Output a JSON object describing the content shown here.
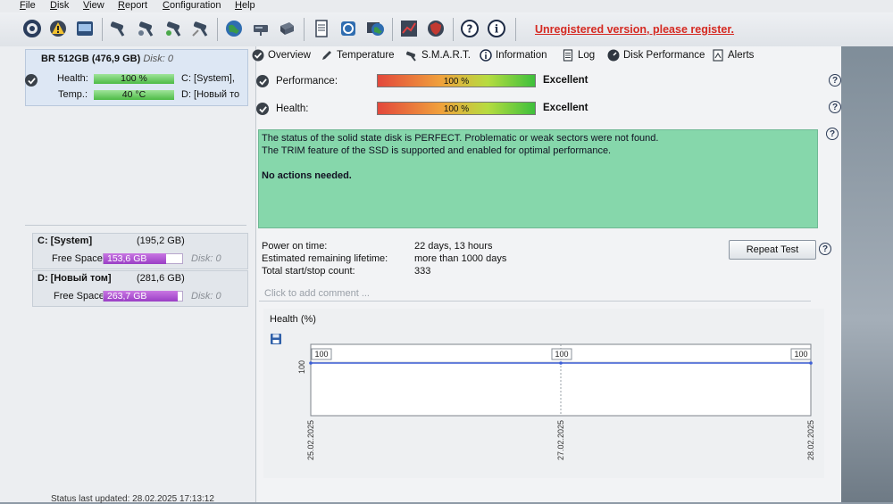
{
  "menu": [
    "File",
    "Disk",
    "View",
    "Report",
    "Configuration",
    "Help"
  ],
  "register_notice": "Unregistered version, please register.",
  "disk": {
    "name": "BR 512GB (476,9 GB)",
    "disk_id": "Disk: 0",
    "health_label": "Health:",
    "health_value": "100 %",
    "health_level": 100,
    "temp_label": "Temp.:",
    "temp_value": "40 °C",
    "temp_level": 100,
    "drive1": "C: [System],",
    "drive2": "D: [Новый то"
  },
  "volumes": [
    {
      "name": "C: [System]",
      "size": "(195,2 GB)",
      "free_label": "Free Space",
      "free_value": "153,6 GB",
      "free_level": 0.79,
      "disk": "Disk: 0"
    },
    {
      "name": "D: [Новый том]",
      "size": "(281,6 GB)",
      "free_label": "Free Space",
      "free_value": "263,7 GB",
      "free_level": 0.94,
      "disk": "Disk: 0"
    }
  ],
  "status_updated": "Status last updated: 28.02.2025 17:13:12",
  "tabs": [
    "Overview",
    "Temperature",
    "S.M.A.R.T.",
    "Information",
    "Log",
    "Disk Performance",
    "Alerts"
  ],
  "overview": {
    "performance_label": "Performance:",
    "performance_value": "100 %",
    "performance_rating": "Excellent",
    "health_label": "Health:",
    "health_value": "100 %",
    "health_rating": "Excellent",
    "status_line1": "The status of the solid state disk is PERFECT. Problematic or weak sectors were not found.",
    "status_line2": "The TRIM feature of the SSD is supported and enabled for optimal performance.",
    "status_line3": "No actions needed."
  },
  "stats": [
    {
      "label": "Power on time:",
      "value": "22 days, 13 hours"
    },
    {
      "label": "Estimated remaining lifetime:",
      "value": "more than 1000 days"
    },
    {
      "label": "Total start/stop count:",
      "value": "333"
    }
  ],
  "repeat_test": "Repeat Test",
  "comment_placeholder": "Click to add comment ...",
  "chart_data": {
    "type": "line",
    "title": "Health (%)",
    "x": [
      "25.02.2025",
      "27.02.2025",
      "28.02.2025"
    ],
    "values": [
      100,
      100,
      100
    ],
    "y_tick": "100",
    "ylim": [
      0,
      100
    ],
    "color": "#3d5fd6"
  }
}
